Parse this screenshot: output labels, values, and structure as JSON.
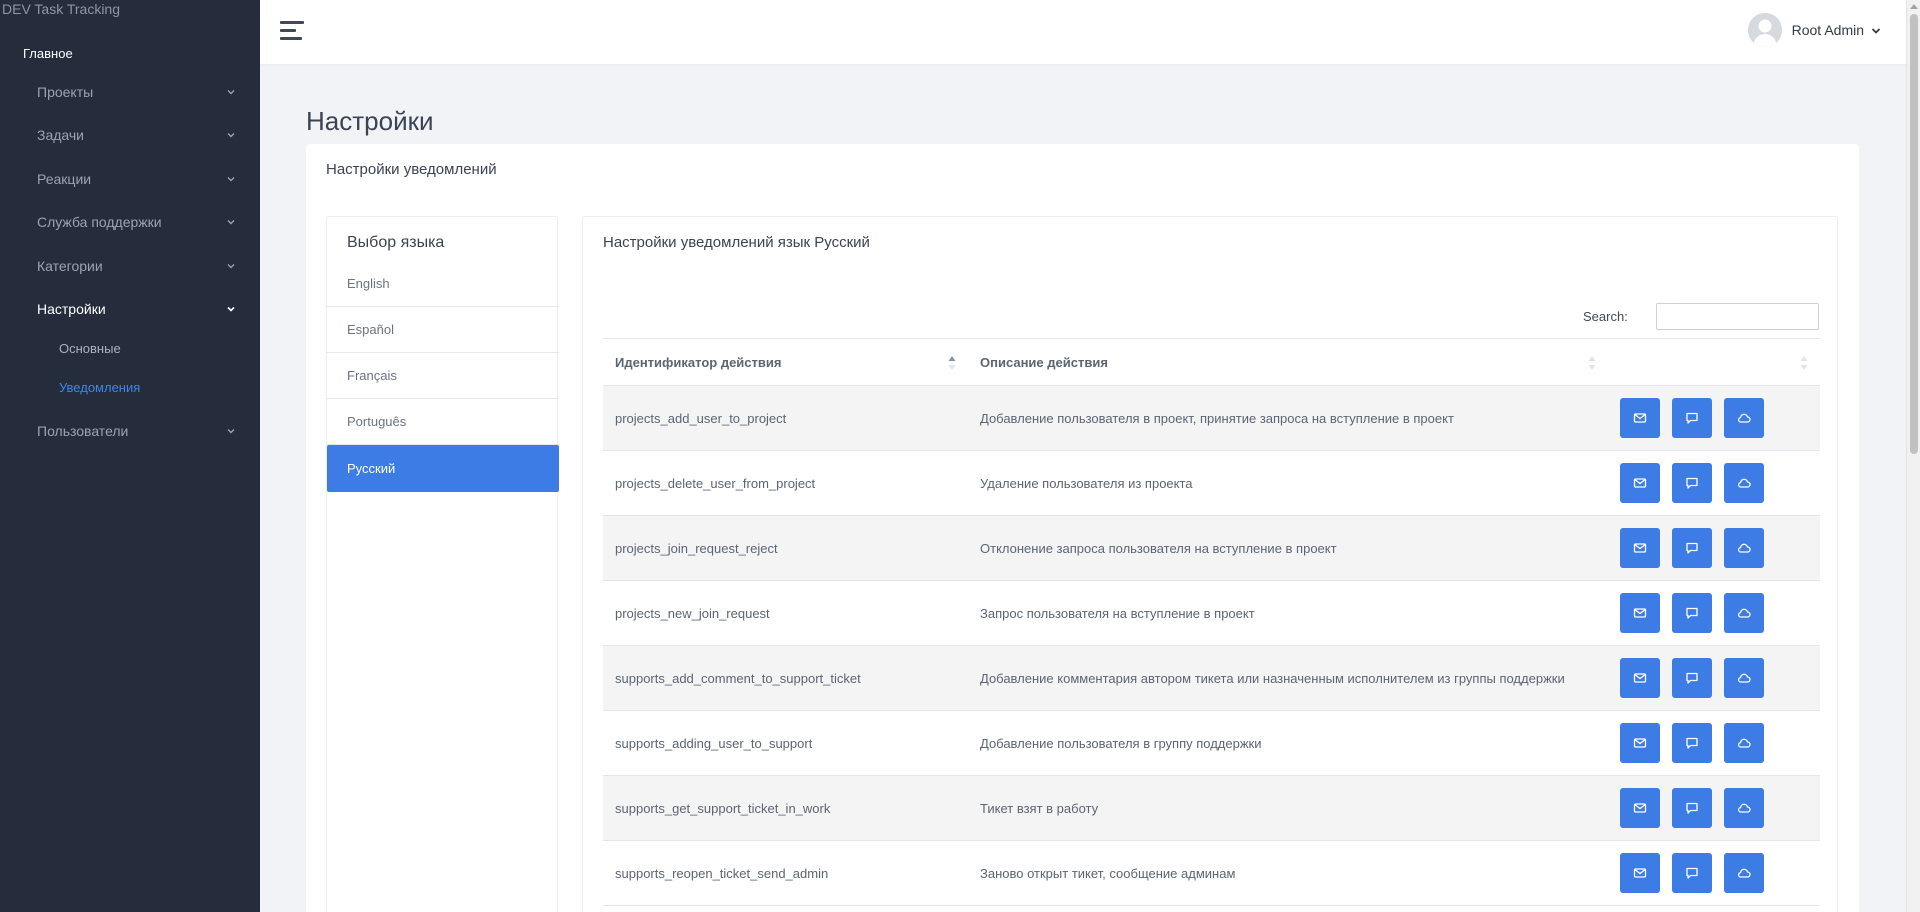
{
  "app": {
    "brand": "DEV Task Tracking"
  },
  "sidebar": {
    "section_title": "Главное",
    "items": [
      {
        "label": "Проекты"
      },
      {
        "label": "Задачи"
      },
      {
        "label": "Реакции"
      },
      {
        "label": "Служба поддержки"
      },
      {
        "label": "Категории"
      },
      {
        "label": "Настройки"
      },
      {
        "label": "Пользователи"
      }
    ],
    "sub_items": [
      {
        "label": "Основные"
      },
      {
        "label": "Уведомления"
      }
    ]
  },
  "header": {
    "user_name": "Root Admin"
  },
  "page": {
    "title": "Настройки",
    "card_title": "Настройки уведомлений"
  },
  "languages": {
    "title": "Выбор языка",
    "items": [
      {
        "label": "English"
      },
      {
        "label": "Español"
      },
      {
        "label": "Français"
      },
      {
        "label": "Português"
      },
      {
        "label": "Русский"
      }
    ],
    "selected": "Русский"
  },
  "notifications": {
    "title": "Настройки уведомлений язык Русский",
    "search_label": "Search:",
    "search_value": "",
    "columns": {
      "action_id": "Идентификатор действия",
      "description": "Описание действия",
      "actions": ""
    },
    "rows": [
      {
        "id": "projects_add_user_to_project",
        "description": "Добавление пользователя в проект, принятие запроса на вступление в проект"
      },
      {
        "id": "projects_delete_user_from_project",
        "description": "Удаление пользователя из проекта"
      },
      {
        "id": "projects_join_request_reject",
        "description": "Отклонение запроса пользователя на вступление в проект"
      },
      {
        "id": "projects_new_join_request",
        "description": "Запрос пользователя на вступление в проект"
      },
      {
        "id": "supports_add_comment_to_support_ticket",
        "description": "Добавление комментария автором тикета или назначенным исполнителем из группы поддержки"
      },
      {
        "id": "supports_adding_user_to_support",
        "description": "Добавление пользователя в группу поддержки"
      },
      {
        "id": "supports_get_support_ticket_in_work",
        "description": "Тикет взят в работу"
      },
      {
        "id": "supports_reopen_ticket_send_admin",
        "description": "Заново открыт тикет, сообщение админам"
      }
    ]
  },
  "icons": {
    "menu": "hamburger-icon",
    "email": "mail-icon",
    "chat": "chat-icon",
    "cloud": "cloud-icon",
    "chevron": "chevron-down-icon",
    "avatar": "user-avatar-icon"
  },
  "colors": {
    "sidebar_bg": "#252d3c",
    "accent": "#3d7ce4",
    "active_sub": "#3d86e8",
    "page_bg": "#f1f3f7"
  }
}
